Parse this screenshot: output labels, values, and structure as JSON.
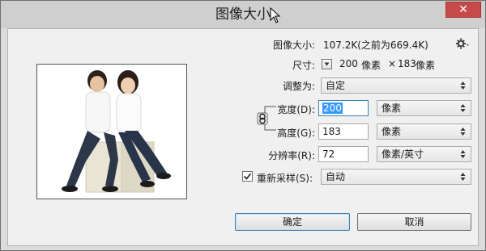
{
  "window": {
    "title": "图像大小",
    "close_label": "✕"
  },
  "image_size": {
    "label": "图像大小:",
    "value": "107.2K(之前为669.4K)"
  },
  "dimensions": {
    "label": "尺寸:",
    "width": "200",
    "width_unit": "像素",
    "times": "×",
    "height": "183",
    "height_unit": "像素"
  },
  "fit_to": {
    "label": "调整为:",
    "value": "自定"
  },
  "width": {
    "label": "宽度(D):",
    "value": "200",
    "unit": "像素"
  },
  "height": {
    "label": "高度(G):",
    "value": "183",
    "unit": "像素"
  },
  "resolution": {
    "label": "分辨率(R):",
    "value": "72",
    "unit": "像素/英寸"
  },
  "resample": {
    "label": "重新采样(S):",
    "checked": true,
    "value": "自动"
  },
  "buttons": {
    "ok": "确定",
    "cancel": "取消"
  },
  "colors": {
    "title_bg": "#cfcfcf",
    "close_bg": "#c74a4a",
    "selection": "#3399ff",
    "client_bg": "#f0f0f0"
  },
  "icons": {
    "settings": "gear-icon",
    "link": "chain-link-icon",
    "close": "close-icon",
    "cursor": "mouse-pointer-icon"
  }
}
